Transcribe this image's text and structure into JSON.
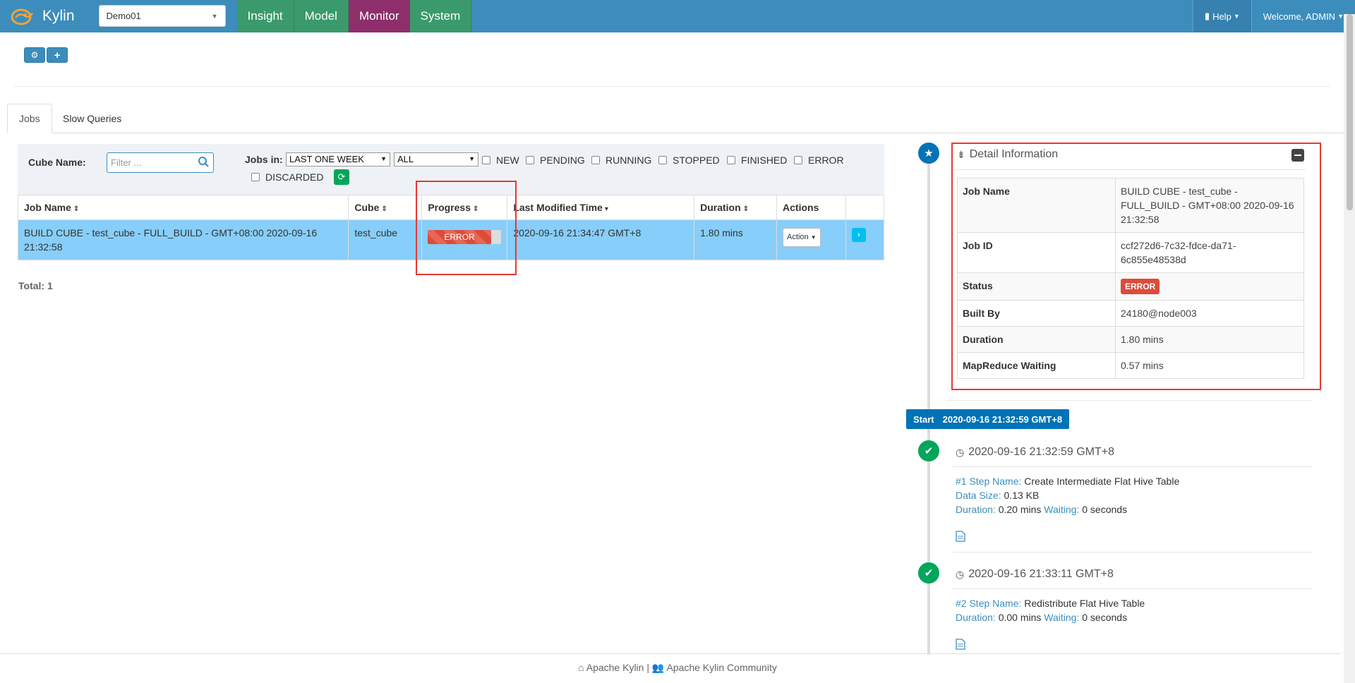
{
  "navbar": {
    "brand": "Kylin",
    "project": "Demo01",
    "tabs": [
      "Insight",
      "Model",
      "Monitor",
      "System"
    ],
    "help": "Help",
    "welcome": "Welcome, ADMIN"
  },
  "tabs": [
    "Jobs",
    "Slow Queries"
  ],
  "filter": {
    "cube_name_label": "Cube Name:",
    "cube_name_placeholder": "Filter ...",
    "jobs_in_label": "Jobs in:",
    "time_range": "LAST ONE WEEK",
    "job_type": "ALL",
    "statuses": [
      "NEW",
      "PENDING",
      "RUNNING",
      "STOPPED",
      "FINISHED",
      "ERROR",
      "DISCARDED"
    ]
  },
  "table": {
    "headers": [
      "Job Name",
      "Cube",
      "Progress",
      "Last Modified Time",
      "Duration",
      "Actions"
    ],
    "row": {
      "job_name": "BUILD CUBE - test_cube - FULL_BUILD - GMT+08:00 2020-09-16 21:32:58",
      "cube": "test_cube",
      "progress_label": "ERROR",
      "progress": 0.86,
      "last_modified": "2020-09-16 21:34:47 GMT+8",
      "duration": "1.80 mins",
      "action": "Action"
    },
    "total": "Total: 1"
  },
  "detail": {
    "title": "Detail Information",
    "rows": [
      {
        "k": "Job Name",
        "v": "BUILD CUBE - test_cube - FULL_BUILD - GMT+08:00 2020-09-16 21:32:58"
      },
      {
        "k": "Job ID",
        "v": "ccf272d6-7c32-fdce-da71-6c855e48538d"
      },
      {
        "k": "Status",
        "v": "ERROR"
      },
      {
        "k": "Built By",
        "v": "24180@node003"
      },
      {
        "k": "Duration",
        "v": "1.80 mins"
      },
      {
        "k": "MapReduce Waiting",
        "v": "0.57 mins"
      }
    ]
  },
  "timeline": {
    "start_label": "Start",
    "start_time": "2020-09-16 21:32:59 GMT+8",
    "steps": [
      {
        "time": "2020-09-16 21:32:59 GMT+8",
        "step_label": "#1 Step Name:",
        "step_name": "Create Intermediate Flat Hive Table",
        "data_size_label": "Data Size:",
        "data_size": "0.13 KB",
        "duration_label": "Duration:",
        "duration": "0.20 mins",
        "waiting_label": "Waiting:",
        "waiting": "0 seconds"
      },
      {
        "time": "2020-09-16 21:33:11 GMT+8",
        "step_label": "#2 Step Name:",
        "step_name": "Redistribute Flat Hive Table",
        "duration_label": "Duration:",
        "duration": "0.00 mins",
        "waiting_label": "Waiting:",
        "waiting": "0 seconds"
      }
    ]
  },
  "footer": {
    "left": "Apache Kylin",
    "separator": "|",
    "right": "Apache Kylin Community"
  },
  "colors": {
    "navbar": "#3c8dbc",
    "active_tab": "#8e2e6b",
    "green_tab": "#3a9a6b",
    "selected_row": "#87cefa",
    "error": "#dd4b39",
    "highlight": "#e53935"
  }
}
